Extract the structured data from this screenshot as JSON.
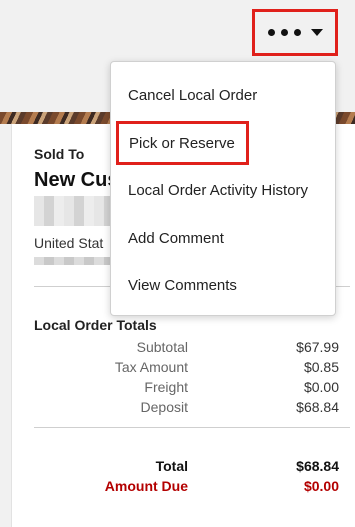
{
  "toolbar": {
    "more_icon": "ellipsis-icon",
    "caret_icon": "caret-down-icon",
    "highlight_color": "#e0201b"
  },
  "order": {
    "sold_to_label": "Sold To",
    "customer_name": "New Cus",
    "country": "United Stat"
  },
  "totals": {
    "title": "Local Order Totals",
    "rows": [
      {
        "label": "Subtotal",
        "value": "$67.99"
      },
      {
        "label": "Tax Amount",
        "value": "$0.85"
      },
      {
        "label": "Freight",
        "value": "$0.00"
      },
      {
        "label": "Deposit",
        "value": "$68.84"
      }
    ],
    "total_label": "Total",
    "total_value": "$68.84",
    "amount_due_label": "Amount Due",
    "amount_due_value": "$0.00",
    "amount_due_color": "#b30000"
  },
  "menu": {
    "items": [
      {
        "label": "Cancel Local Order"
      },
      {
        "label": "Pick or Reserve"
      },
      {
        "label": "Local Order Activity History"
      },
      {
        "label": "Add Comment"
      },
      {
        "label": "View Comments"
      }
    ]
  }
}
